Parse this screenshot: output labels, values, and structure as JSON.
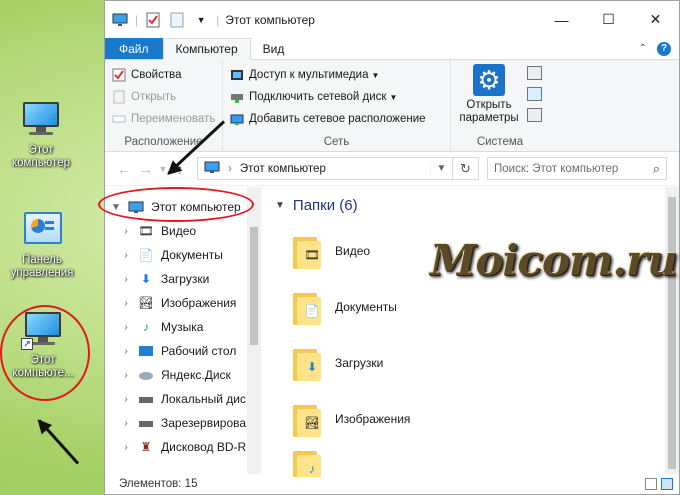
{
  "desktop": {
    "icons": [
      {
        "label": "Этот компьютер",
        "name": "this-pc"
      },
      {
        "label": "Панель управления",
        "name": "control-panel"
      },
      {
        "label": "Этот компьюте...",
        "name": "this-pc-shortcut"
      }
    ],
    "shortcut_glyph": "↗"
  },
  "window": {
    "title": "Этот компьютер",
    "controls": {
      "minimize": "—",
      "maximize": "☐",
      "close": "✕"
    },
    "ribbon_tabs": [
      "Файл",
      "Компьютер",
      "Вид"
    ],
    "ribbon_right": {
      "collapse": "⌃",
      "help": "?"
    },
    "ribbon": {
      "location": {
        "label": "Расположение",
        "items": [
          {
            "label": "Свойства",
            "icon": "properties-icon",
            "enabled": true
          },
          {
            "label": "Открыть",
            "icon": "open-icon",
            "enabled": false
          },
          {
            "label": "Переименовать",
            "icon": "rename-icon",
            "enabled": false
          }
        ]
      },
      "network": {
        "label": "Сеть",
        "items": [
          {
            "label": "Доступ к мультимедиа",
            "icon": "media-access-icon",
            "dropdown": true
          },
          {
            "label": "Подключить сетевой диск",
            "icon": "map-drive-icon",
            "dropdown": true
          },
          {
            "label": "Добавить сетевое расположение",
            "icon": "add-location-icon",
            "dropdown": false
          }
        ]
      },
      "system": {
        "label": "Система",
        "open_settings": "Открыть параметры",
        "small_icons": [
          "uninstall-icon",
          "system-properties-icon",
          "manage-icon"
        ]
      }
    },
    "address": {
      "path": "Этот компьютер",
      "search_placeholder": "Поиск: Этот компьютер"
    },
    "nav": {
      "root": "Этот компьютер",
      "items": [
        {
          "label": "Видео",
          "icon": "video-icon"
        },
        {
          "label": "Документы",
          "icon": "documents-icon"
        },
        {
          "label": "Загрузки",
          "icon": "downloads-icon"
        },
        {
          "label": "Изображения",
          "icon": "pictures-icon"
        },
        {
          "label": "Музыка",
          "icon": "music-icon"
        },
        {
          "label": "Рабочий стол",
          "icon": "desktop-icon"
        },
        {
          "label": "Яндекс.Диск",
          "icon": "yandex-disk-icon"
        },
        {
          "label": "Локальный дис",
          "icon": "local-disk-icon"
        },
        {
          "label": "Зарезервирова",
          "icon": "reserved-disk-icon"
        },
        {
          "label": "Дисковод BD-R",
          "icon": "bd-drive-icon"
        }
      ]
    },
    "folders_group": "Папки (6)",
    "folders": [
      {
        "label": "Видео",
        "badge": "🎞"
      },
      {
        "label": "Документы",
        "badge": "📄"
      },
      {
        "label": "Загрузки",
        "badge": "⬇"
      },
      {
        "label": "Изображения",
        "badge": "🏞"
      },
      {
        "label": "",
        "badge": "♪"
      }
    ],
    "status": "Элементов: 15"
  },
  "watermark": "Moicom.ru",
  "colors": {
    "accent": "#1979ca",
    "annotation_red": "#e0191e",
    "group_heading": "#1e3287"
  }
}
